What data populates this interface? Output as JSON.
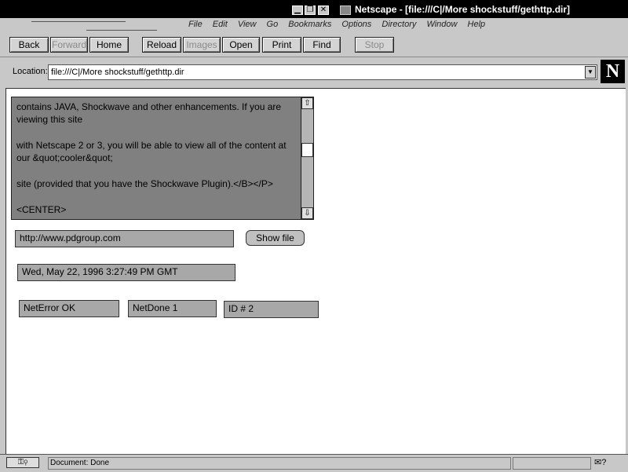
{
  "window": {
    "title": "Netscape - [file:///C|/More shockstuff/gethttp.dir]",
    "controls": [
      "▁",
      "❐",
      "✕"
    ]
  },
  "menu": [
    "File",
    "Edit",
    "View",
    "Go",
    "Bookmarks",
    "Options",
    "Directory",
    "Window",
    "Help"
  ],
  "toolbar": {
    "back": "Back",
    "forward": "Forward",
    "home": "Home",
    "reload": "Reload",
    "images": "Images",
    "open": "Open",
    "print": "Print",
    "find": "Find",
    "stop": "Stop"
  },
  "location": {
    "label": "Location:",
    "url": "file:///C|/More shockstuff/gethttp.dir",
    "logo": "N"
  },
  "page": {
    "source_lines": [
      " contains JAVA, Shockwave and other enhancements. If you are viewing this site",
      "with Netscape 2 or 3, you will be able to view all of the content  at our &quot;cooler&quot;",
      "site (provided that you have the Shockwave Plugin).</B></P>",
      "<CENTER>"
    ],
    "url_field": "http://www.pdgroup.com",
    "show_file_label": "Show file",
    "date_field": "Wed, May 22, 1996 3:27:49 PM GMT",
    "net_error": "NetError OK",
    "net_done": "NetDone 1",
    "id_field": "ID # 2"
  },
  "status": {
    "text": "Document: Done",
    "mail_icon": "✉?"
  }
}
